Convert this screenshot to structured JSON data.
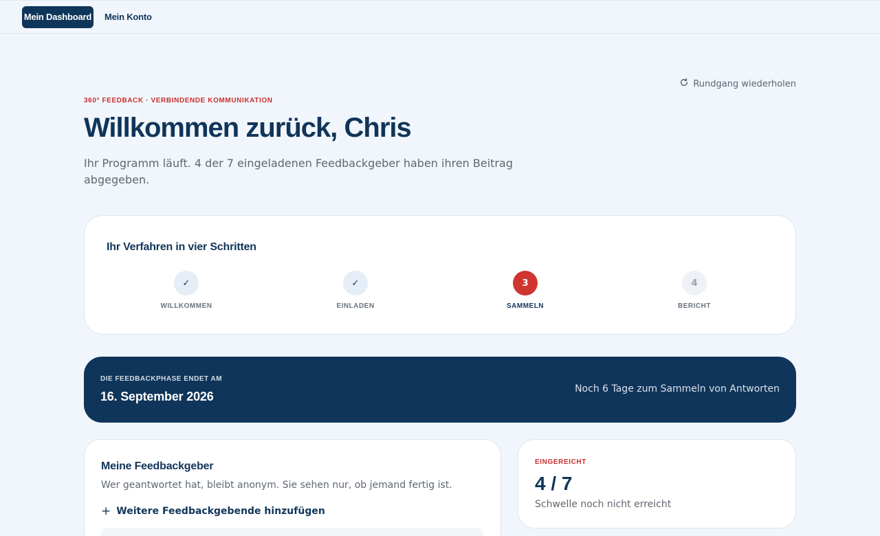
{
  "nav": {
    "items": [
      {
        "label": "Mein Dashboard",
        "active": true
      },
      {
        "label": "Mein Konto",
        "active": false
      }
    ]
  },
  "header": {
    "replay_label": "Rundgang wiederholen",
    "eyebrow": "360° FEEDBACK · VERBINDENDE KOMMUNIKATION",
    "title": "Willkommen zurück, Chris",
    "subtitle": "Ihr Programm läuft. 4 der 7 eingeladenen Feedbackgeber haben ihren Beitrag abgegeben."
  },
  "steps": {
    "title": "Ihr Verfahren in vier Schritten",
    "items": [
      {
        "marker": "✓",
        "label": "WILLKOMMEN",
        "state": "done"
      },
      {
        "marker": "✓",
        "label": "EINLADEN",
        "state": "done"
      },
      {
        "marker": "3",
        "label": "SAMMELN",
        "state": "current"
      },
      {
        "marker": "4",
        "label": "BERICHT",
        "state": "todo"
      }
    ]
  },
  "deadline": {
    "label": "DIE FEEDBACKPHASE ENDET AM",
    "date": "16. September 2026",
    "remaining": "Noch 6 Tage zum Sammeln von Antworten"
  },
  "feedbackgeber": {
    "title": "Meine Feedbackgeber",
    "description": "Wer geantwortet hat, bleibt anonym. Sie sehen nur, ob jemand fertig ist.",
    "add_icon": "+",
    "add_label": "Weitere Feedbackgebende hinzufügen"
  },
  "status": {
    "label": "EINGEREICHT",
    "value": "4 / 7",
    "note": "Schwelle noch nicht erreicht"
  },
  "colors": {
    "navy": "#10355a",
    "accent_red": "#d03530",
    "background": "#f1f6fc"
  }
}
